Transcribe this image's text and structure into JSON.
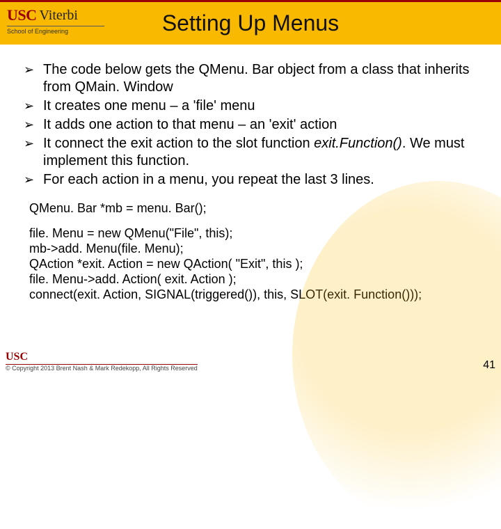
{
  "header": {
    "logo_usc": "USC",
    "logo_viterbi": "Viterbi",
    "logo_school": "School of Engineering",
    "title": "Setting Up Menus"
  },
  "bullets": [
    {
      "text": "The code below gets the QMenu. Bar object from a class that inherits from QMain. Window"
    },
    {
      "text": "It creates one menu – a 'file' menu"
    },
    {
      "text": "It adds one action to that menu – an 'exit' action"
    },
    {
      "text_pre": "It connect the exit action to the slot function ",
      "em": "exit.Function()",
      "text_post": ". We must implement this function."
    },
    {
      "text": "For each action in a menu, you repeat the last 3 lines."
    }
  ],
  "code": {
    "group1": [
      "QMenu. Bar *mb = menu. Bar();"
    ],
    "group2": [
      "file. Menu = new QMenu(\"File\", this);",
      "mb->add. Menu(file. Menu);",
      "QAction *exit. Action = new QAction( \"Exit\", this );",
      "file. Menu->add. Action( exit. Action );",
      "connect(exit. Action, SIGNAL(triggered()), this, SLOT(exit. Function()));"
    ]
  },
  "footer": {
    "usc_small": "USC",
    "copyright": "© Copyright 2013 Brent Nash & Mark Redekopp, All Rights Reserved",
    "page": "41"
  }
}
